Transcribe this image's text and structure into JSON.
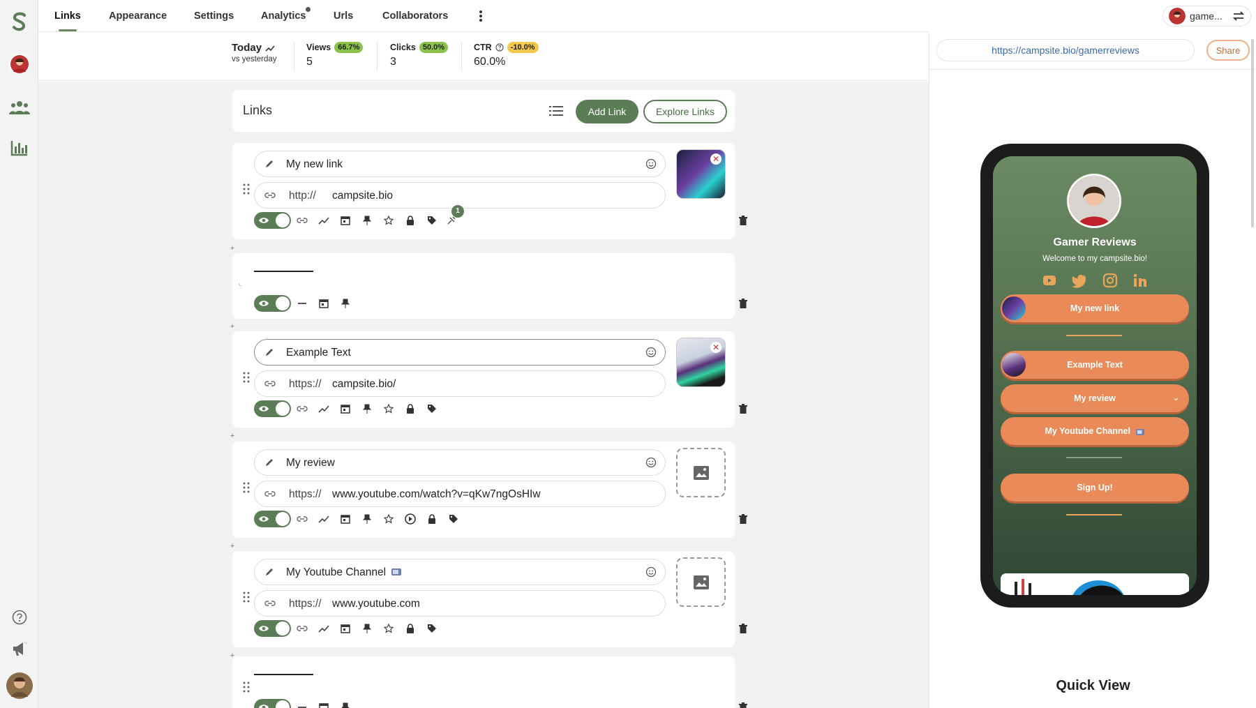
{
  "nav": {
    "tabs": [
      {
        "label": "Links"
      },
      {
        "label": "Appearance"
      },
      {
        "label": "Settings"
      },
      {
        "label": "Analytics"
      },
      {
        "label": "Urls"
      },
      {
        "label": "Collaborators"
      }
    ],
    "user_label": "game..."
  },
  "stats": {
    "today_label": "Today",
    "vs_label": "vs yesterday",
    "views_label": "Views",
    "views_change": "66.7%",
    "views_value": "5",
    "clicks_label": "Clicks",
    "clicks_change": "50.0%",
    "clicks_value": "3",
    "ctr_label": "CTR",
    "ctr_change": "-10.0%",
    "ctr_value": "60.0%"
  },
  "links_panel": {
    "title": "Links",
    "add_label": "Add Link",
    "explore_label": "Explore Links"
  },
  "cards": {
    "c1": {
      "title": "My new link",
      "proto": "http://",
      "url": "campsite.bio",
      "badge": "1"
    },
    "c3": {
      "title": "Example Text",
      "proto": "https://",
      "url": "campsite.bio/"
    },
    "c4": {
      "title": "My review",
      "proto": "https://",
      "url": "www.youtube.com/watch?v=qKw7ngOsHIw"
    },
    "c5": {
      "title": "My Youtube Channel",
      "proto": "https://",
      "url": "www.youtube.com"
    }
  },
  "preview": {
    "url": "https://campsite.bio/gamerreviews",
    "share_label": "Share",
    "profile_name": "Gamer Reviews",
    "welcome": "Welcome to my campsite.bio!",
    "buttons": {
      "b1": "My new link",
      "b2": "Example Text",
      "b3": "My review",
      "b4": "My Youtube Channel",
      "b5": "Sign Up!"
    },
    "quick_view": "Quick View"
  },
  "colors": {
    "brand_green": "#5b7d55",
    "accent_orange": "#e98a58"
  }
}
